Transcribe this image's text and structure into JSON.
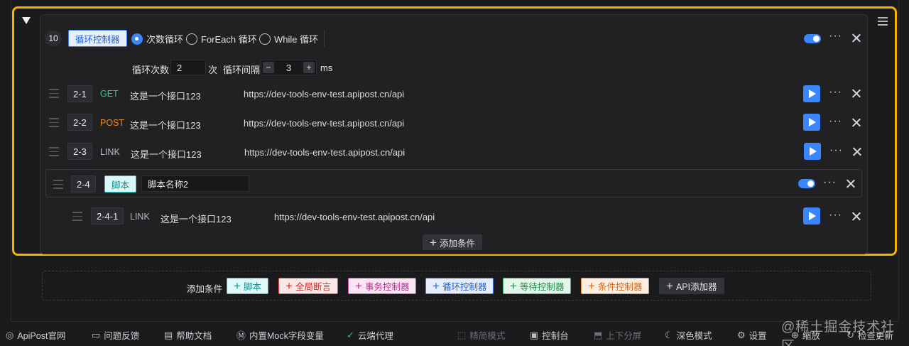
{
  "loop_controller": {
    "index": "10",
    "type_tag": "循环控制器",
    "modes": [
      "次数循环",
      "ForEach 循环",
      "While 循环"
    ],
    "selected_mode": "次数循环",
    "count_label": "循环次数",
    "count_value": "2",
    "count_unit": "次",
    "interval_label": "循环间隔",
    "interval_minus": "−",
    "interval_value": "3",
    "interval_plus": "+",
    "interval_unit": "ms",
    "enabled": true
  },
  "requests": [
    {
      "id": "2-1",
      "method": "GET",
      "name": "这是一个接口123",
      "url": "https://dev-tools-env-test.apipost.cn/api"
    },
    {
      "id": "2-2",
      "method": "POST",
      "name": "这是一个接口123",
      "url": "https://dev-tools-env-test.apipost.cn/api"
    },
    {
      "id": "2-3",
      "method": "LINK",
      "name": "这是一个接口123",
      "url": "https://dev-tools-env-test.apipost.cn/api"
    }
  ],
  "script_block": {
    "id": "2-4",
    "tag": "脚本",
    "name_value": "脚本名称2",
    "enabled": true,
    "child": {
      "id": "2-4-1",
      "method": "LINK",
      "name": "这是一个接口123",
      "url": "https://dev-tools-env-test.apipost.cn/api"
    }
  },
  "more_label": "···",
  "add_condition_inner": "添加条件",
  "add_condition_panel": {
    "label": "添加条件",
    "buttons": [
      "脚本",
      "全局断言",
      "事务控制器",
      "循环控制器",
      "等待控制器",
      "条件控制器",
      "API添加器"
    ]
  },
  "statusbar": {
    "items": [
      {
        "label": "ApiPost官网",
        "icon": "apipost-logo-icon"
      },
      {
        "label": "问题反馈",
        "icon": "feedback-icon"
      },
      {
        "label": "帮助文档",
        "icon": "docs-icon"
      },
      {
        "label": "内置Mock字段变量",
        "icon": "mock-icon"
      },
      {
        "label": "云端代理",
        "icon": "cloud-proxy-check-icon"
      },
      {
        "label": "精简模式",
        "icon": "compact-mode-icon"
      },
      {
        "label": "控制台",
        "icon": "console-icon"
      },
      {
        "label": "上下分屏",
        "icon": "split-icon"
      },
      {
        "label": "深色模式",
        "icon": "moon-icon"
      },
      {
        "label": "设置",
        "icon": "gear-icon"
      },
      {
        "label": "缩放",
        "icon": "zoom-icon"
      },
      {
        "label": "检查更新",
        "icon": "update-icon"
      }
    ]
  },
  "watermark": "@稀土掘金技术社区",
  "colors": {
    "accent": "#3a86ff",
    "selection": "#f5b400",
    "get": "#3ec08a",
    "post": "#f08a24"
  }
}
